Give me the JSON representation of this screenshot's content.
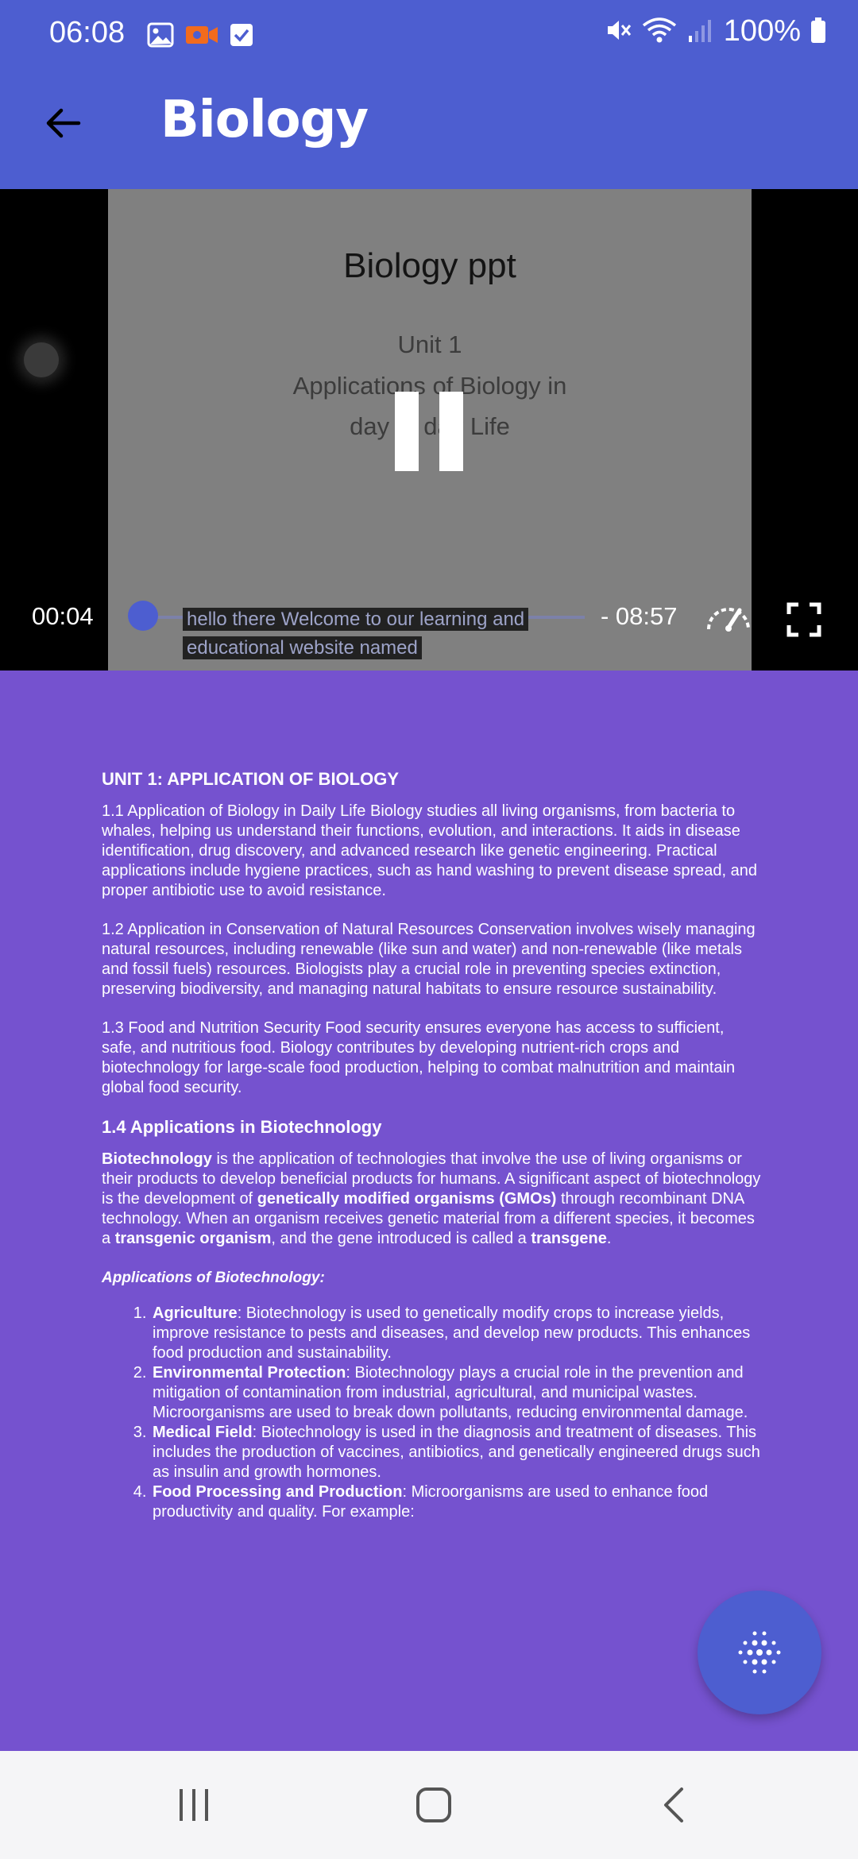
{
  "status": {
    "time": "06:08",
    "battery": "100%",
    "left_icons": [
      "gallery-icon",
      "video-record-icon",
      "checkbox-icon"
    ],
    "right_icons": [
      "mute-icon",
      "wifi-icon",
      "signal-icon",
      "battery-icon"
    ],
    "record_icon_color": "#F26B1D"
  },
  "app_bar": {
    "title": "Biology",
    "back_icon": "arrow-back-icon"
  },
  "video": {
    "slide_title": "Biology ppt",
    "slide_lines": [
      "Unit 1",
      "Applications of Biology in",
      "day to day Life"
    ],
    "current_time": "00:04",
    "remaining_time": "- 08:57",
    "caption_lines": [
      "hello there Welcome to our learning and",
      "educational website named"
    ],
    "progress_fraction": 0.0075,
    "state": "playing",
    "accent": "#4D5ED0"
  },
  "document": {
    "unit_heading": "UNIT 1: APPLICATION  OF BIOLOGY",
    "p1": "1.1 Application of Biology in Daily Life Biology studies all living organisms, from bacteria to whales, helping us understand their functions, evolution, and interactions. It aids in disease identification, drug discovery, and advanced research like genetic engineering. Practical applications include hygiene practices, such as hand washing to prevent disease spread, and proper antibiotic use to avoid resistance.",
    "p2": "1.2 Application in Conservation of Natural Resources Conservation involves wisely managing natural resources, including renewable (like sun and water) and non-renewable (like metals and fossil fuels) resources. Biologists play a crucial role in preventing species extinction, preserving biodiversity, and managing natural habitats to ensure resource sustainability.",
    "p3": "1.3 Food and Nutrition Security Food security ensures everyone has access to sufficient, safe, and nutritious food. Biology contributes by developing nutrient-rich crops and biotechnology for large-scale food production, helping to combat malnutrition and maintain global food security.",
    "biotech_heading": "1.4 Applications in Biotechnology",
    "biotech_p": {
      "b1": "Biotechnology",
      "t1": " is the application of technologies that involve the use of living organisms or their products to develop beneficial products for humans. A significant aspect of biotechnology is the development of ",
      "b2": "genetically modified organisms (GMOs)",
      "t2": " through recombinant DNA technology. When an organism receives genetic material from a different species, it becomes a ",
      "b3": "transgenic organism",
      "t3": ", and the gene introduced is called a ",
      "b4": "transgene",
      "t4": "."
    },
    "apps_title": "Applications of Biotechnology:",
    "apps": [
      {
        "term": "Agriculture",
        "text": ": Biotechnology is used to genetically modify crops to increase yields, improve resistance to pests and diseases, and develop new products. This enhances food production and sustainability."
      },
      {
        "term": "Environmental Protection",
        "text": ": Biotechnology plays a crucial role in the prevention and mitigation of contamination from industrial, agricultural, and municipal wastes. Microorganisms are used to break down pollutants, reducing environmental damage."
      },
      {
        "term": "Medical Field",
        "text": ": Biotechnology is used in the diagnosis and treatment of diseases. This includes the production of vaccines, antibiotics, and genetically engineered drugs such as insulin and growth hormones."
      },
      {
        "term": "Food Processing and Production",
        "text": ": Microorganisms are used to enhance food productivity and quality. For example:"
      }
    ]
  },
  "fab": {
    "icon": "dotted-grid-icon"
  },
  "nav": {
    "icons": [
      "recents-icon",
      "home-icon",
      "back-icon"
    ]
  },
  "colors": {
    "app_bar": "#4D5ED0",
    "page_background": "#7552CF",
    "nav_background": "#F5F5F7"
  }
}
